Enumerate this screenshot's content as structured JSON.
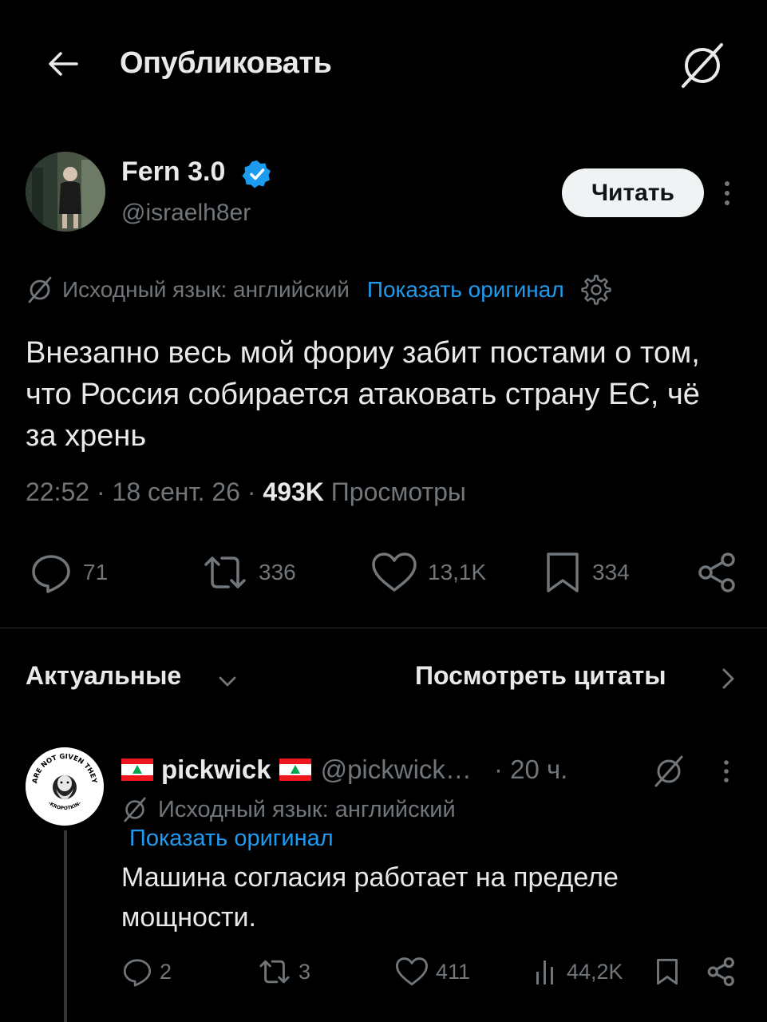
{
  "header": {
    "title": "Опубликовать",
    "back_icon": "arrow-left-icon",
    "grok_icon": "grok-icon"
  },
  "post": {
    "author_name": "Fern 3.0",
    "author_handle": "@israelh8er",
    "verified_icon": "verified-badge-icon",
    "follow_label": "Читать",
    "translate_label": "Исходный язык: английский",
    "show_original_label": "Показать оригинал",
    "text": "Внезапно весь мой фориу забит постами о том, что Россия собирается атаковать страну ЕС, чё за хрень",
    "time": "22:52",
    "sep1": " · ",
    "date": "18 сент. 26",
    "sep2": " · ",
    "views_count": "493K",
    "views_label": " Просмотры",
    "replies": "71",
    "reposts": "336",
    "likes": "13,1K",
    "bookmarks": "334"
  },
  "sort": {
    "label": "Актуальные",
    "quotes_label": "Посмотреть цитаты"
  },
  "reply": {
    "author_name": "pickwick",
    "author_handle": "@pickwick…",
    "time": "· 20 ч.",
    "avatar_text_top": "FREEDOMS ARE NOT GIVEN THEY ARE TAKEN",
    "avatar_text_bottom": "-KROPOTKIN-",
    "translate_label": "Исходный язык: английский",
    "show_original_label": "Показать оригинал",
    "text": "Машина согласия работает на пределе мощности.",
    "replies": "2",
    "reposts": "3",
    "likes": "411",
    "views": "44,2K"
  },
  "colors": {
    "background": "#000000",
    "text_primary": "#e7e9ea",
    "text_secondary": "#71767b",
    "accent": "#1d9bf0",
    "follow_bg": "#eff3f4",
    "divider": "#2f3336",
    "flag_red": "#ee161f",
    "flag_green": "#00a850"
  }
}
